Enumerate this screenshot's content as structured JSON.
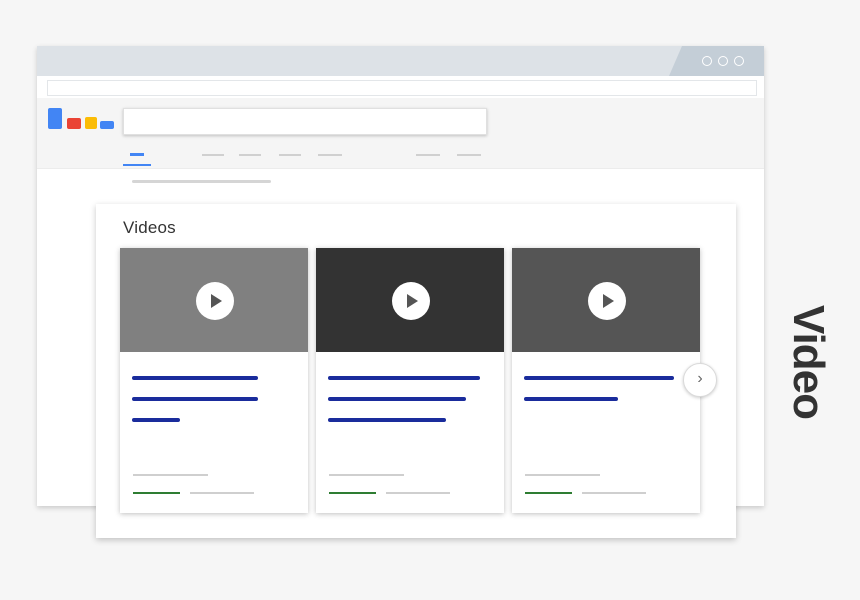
{
  "panel": {
    "title": "Videos",
    "next_symbol": "›"
  },
  "side_label": "Video",
  "colors": {
    "page_bg": "#f6f6f6",
    "titlebar": "#dde2e7",
    "header_bg": "#f5f5f5",
    "link_blue": "#1a2c9c",
    "meta_green": "#2e7d32",
    "tab_active": "#4285f4",
    "logo": [
      "#4285f4",
      "#ea4335",
      "#fbbc05",
      "#4285f4"
    ]
  },
  "cards": [
    {
      "thumbnail_color": "#808080"
    },
    {
      "thumbnail_color": "#333333"
    },
    {
      "thumbnail_color": "#555555"
    }
  ],
  "icons": {
    "play": "play-icon",
    "next": "chevron-right-icon",
    "window_controls": "window-control-icon"
  }
}
